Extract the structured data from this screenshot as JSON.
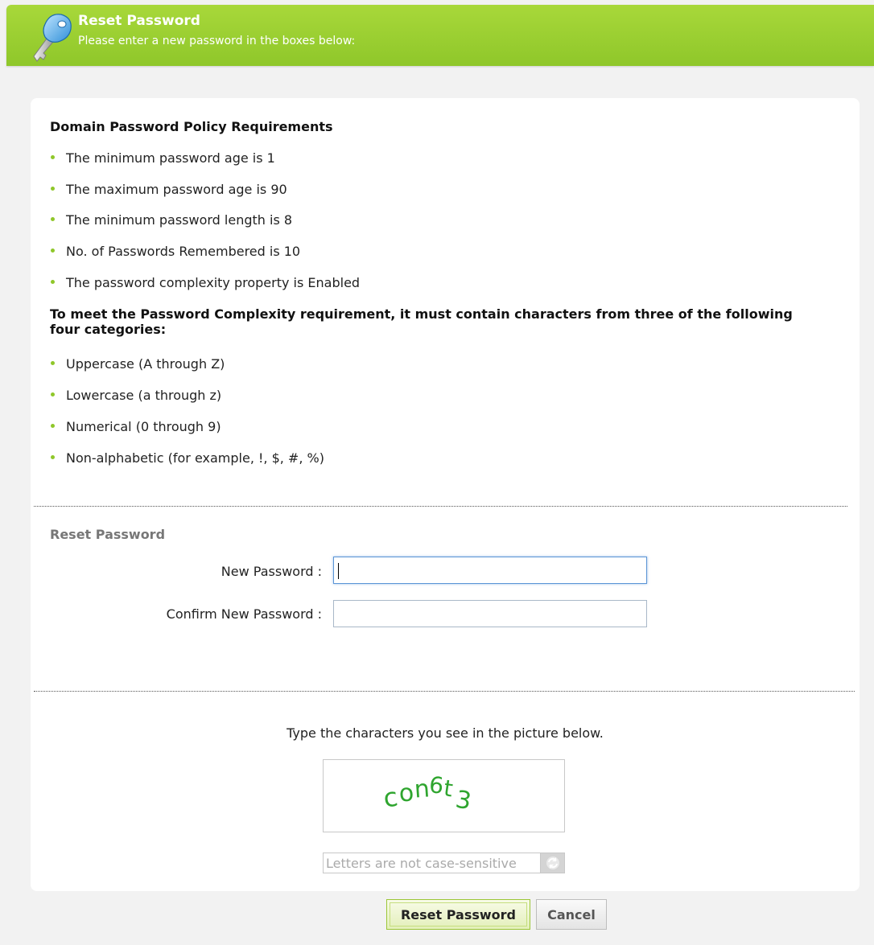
{
  "header": {
    "title": "Reset Password",
    "subtitle": "Please enter a new password in the boxes below:",
    "icon": "key-icon",
    "color": "#9bd032"
  },
  "policy": {
    "heading": "Domain Password Policy Requirements",
    "items": [
      "The minimum password age is 1",
      "The maximum password age is 90",
      "The minimum password length is 8",
      "No. of Passwords Remembered is 10",
      "The password complexity property is Enabled"
    ]
  },
  "complexity": {
    "heading": "To meet the Password Complexity requirement, it must contain characters from three of the following four categories:",
    "items": [
      "Uppercase (A through Z)",
      "Lowercase (a through z)",
      "Numerical (0 through 9)",
      "Non-alphabetic (for example, !, $, #, %)"
    ]
  },
  "form": {
    "section_title": "Reset Password",
    "new_password_label": "New Password :",
    "new_password_value": "",
    "confirm_password_label": "Confirm New Password :",
    "confirm_password_value": ""
  },
  "captcha": {
    "instruction": "Type the characters you see in the picture below.",
    "image_text": "con6t3",
    "input_placeholder": "Letters are not case-sensitive",
    "refresh_icon": "refresh-icon"
  },
  "buttons": {
    "reset_label": "Reset Password",
    "cancel_label": "Cancel"
  }
}
